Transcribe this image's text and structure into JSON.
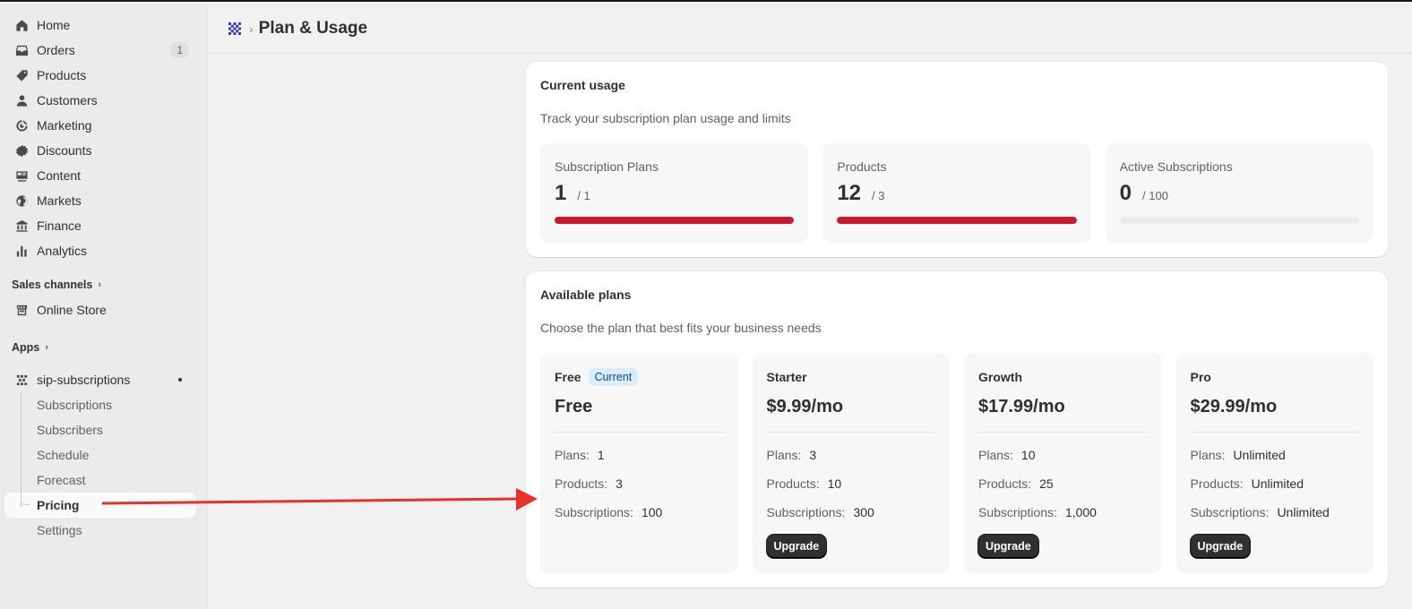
{
  "sidebar": {
    "nav": [
      {
        "label": "Home",
        "icon": "home-icon"
      },
      {
        "label": "Orders",
        "icon": "inbox-icon",
        "badge": "1"
      },
      {
        "label": "Products",
        "icon": "tag-icon"
      },
      {
        "label": "Customers",
        "icon": "person-icon"
      },
      {
        "label": "Marketing",
        "icon": "target-icon"
      },
      {
        "label": "Discounts",
        "icon": "discount-icon"
      },
      {
        "label": "Content",
        "icon": "content-icon"
      },
      {
        "label": "Markets",
        "icon": "globe-icon"
      },
      {
        "label": "Finance",
        "icon": "bank-icon"
      },
      {
        "label": "Analytics",
        "icon": "bar-chart-icon"
      }
    ],
    "sales_channels": "Sales channels",
    "online_store": "Online Store",
    "apps": "Apps",
    "app_name": "sip-subscriptions",
    "sub_items": [
      "Subscriptions",
      "Subscribers",
      "Schedule",
      "Forecast",
      "Pricing",
      "Settings"
    ],
    "active_sub": "Pricing"
  },
  "header": {
    "title": "Plan & Usage"
  },
  "usage": {
    "title": "Current usage",
    "subtitle": "Track your subscription plan usage and limits",
    "items": [
      {
        "label": "Subscription Plans",
        "value": "1",
        "limit": "/ 1",
        "fill_percent": 100
      },
      {
        "label": "Products",
        "value": "12",
        "limit": "/ 3",
        "fill_percent": 100
      },
      {
        "label": "Active Subscriptions",
        "value": "0",
        "limit": "/ 100",
        "fill_percent": 0
      }
    ]
  },
  "plans": {
    "title": "Available plans",
    "subtitle": "Choose the plan that best fits your business needs",
    "current_label": "Current",
    "upgrade_label": "Upgrade",
    "row_labels": {
      "plans": "Plans:",
      "products": "Products:",
      "subscriptions": "Subscriptions:"
    },
    "items": [
      {
        "name": "Free",
        "price": "Free",
        "plans": "1",
        "products": "3",
        "subscriptions": "100",
        "current": true
      },
      {
        "name": "Starter",
        "price": "$9.99/mo",
        "plans": "3",
        "products": "10",
        "subscriptions": "300",
        "current": false
      },
      {
        "name": "Growth",
        "price": "$17.99/mo",
        "plans": "10",
        "products": "25",
        "subscriptions": "1,000",
        "current": false
      },
      {
        "name": "Pro",
        "price": "$29.99/mo",
        "plans": "Unlimited",
        "products": "Unlimited",
        "subscriptions": "Unlimited",
        "current": false
      }
    ]
  },
  "colors": {
    "progress_fill": "#c5192d",
    "annotation_arrow": "#e8312a",
    "app_logo": "#3b3fb8"
  }
}
